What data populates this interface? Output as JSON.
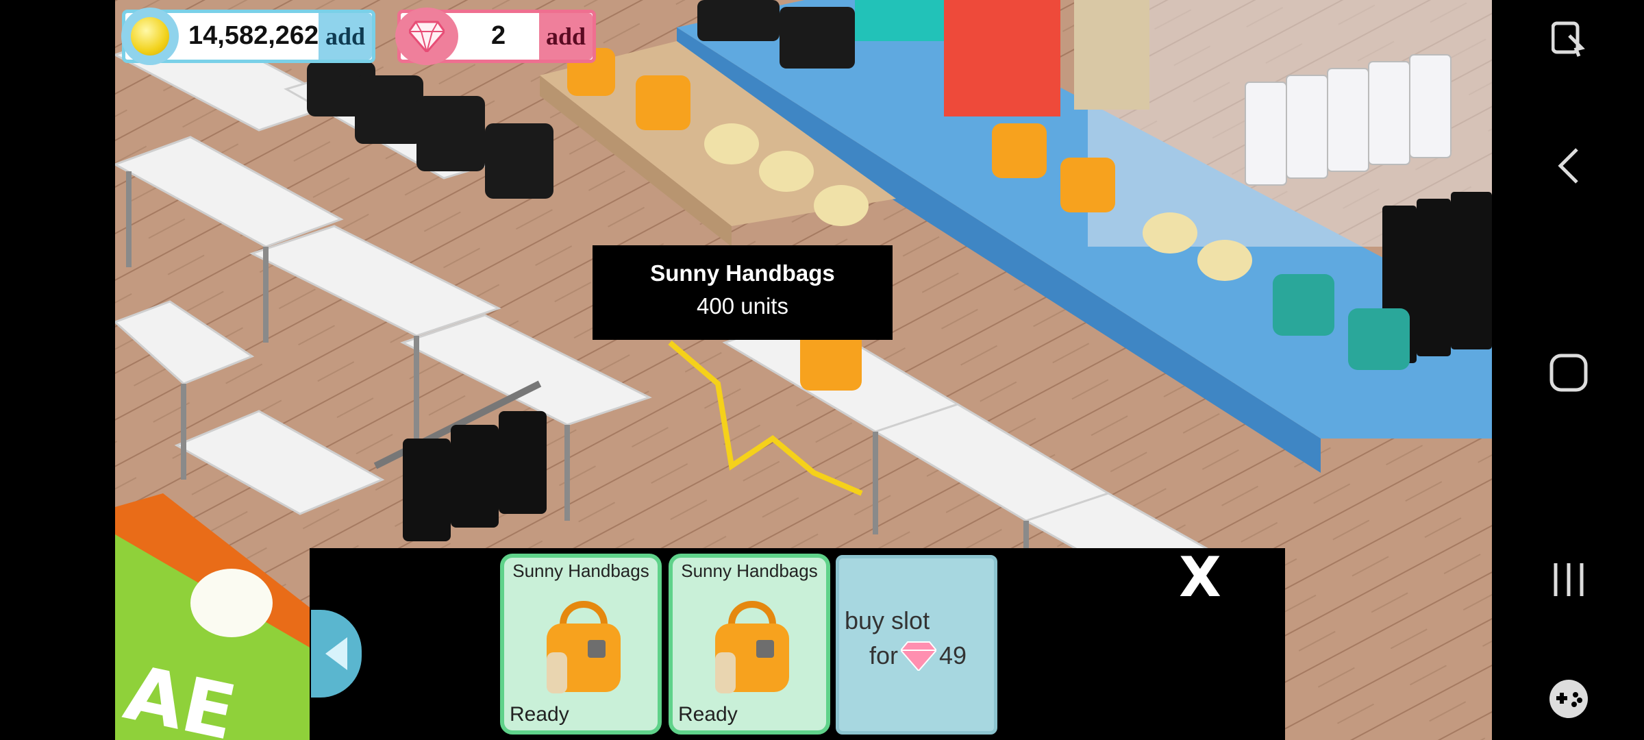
{
  "hud": {
    "coins": "14,582,262",
    "coins_add": "add",
    "gems": "2",
    "gems_add": "add"
  },
  "tooltip": {
    "title": "Sunny Handbags",
    "subtitle": "400 units"
  },
  "panel": {
    "close_label": "X",
    "slots": [
      {
        "name": "Sunny Handbags",
        "status": "Ready"
      },
      {
        "name": "Sunny Handbags",
        "status": "Ready"
      }
    ],
    "buy_slot": {
      "line1": "buy slot",
      "line2_prefix": "for",
      "price": "49"
    }
  },
  "colors": {
    "coin_accent": "#8fd3ec",
    "gem_accent": "#ef7f9b",
    "slot_ready_bg": "#c9f0d8",
    "buy_slot_bg": "#a7d7e0"
  }
}
